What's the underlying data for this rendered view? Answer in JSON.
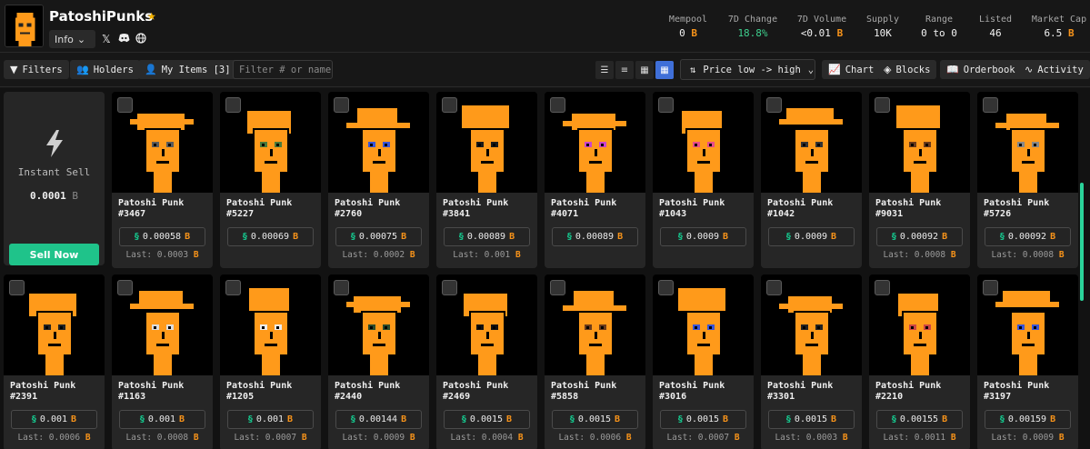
{
  "collection": {
    "name": "PatoshiPunks",
    "info_label": "Info"
  },
  "stats": [
    {
      "label": "Mempool",
      "value": "0",
      "btc": true
    },
    {
      "label": "7D Change",
      "value": "18.8%",
      "btc": false,
      "positive": true
    },
    {
      "label": "7D Volume",
      "value": "<0.01",
      "btc": true
    },
    {
      "label": "Supply",
      "value": "10K",
      "btc": false
    },
    {
      "label": "Range",
      "value": "0 to 0",
      "btc": false
    },
    {
      "label": "Listed",
      "value": "46",
      "btc": false
    },
    {
      "label": "Market Cap",
      "value": "6.5",
      "btc": true
    }
  ],
  "toolbar": {
    "filters": "Filters",
    "holders": "Holders",
    "my_items": "My Items [3]",
    "filter_placeholder": "Filter # or name",
    "sort": "Price low -> high",
    "chart": "Chart",
    "blocks": "Blocks",
    "orderbook": "Orderbook",
    "activity": "Activity"
  },
  "instant_sell": {
    "label": "Instant Sell",
    "price": "0.0001",
    "button": "Sell Now"
  },
  "currency_symbol": "B",
  "colors": {
    "accent": "#f7931a",
    "punk": "#ff9a1a",
    "green": "#1fc38a",
    "active": "#3f6fd8"
  },
  "items": [
    {
      "name": "Patoshi Punk",
      "id": "#3467",
      "price": "0.00058",
      "last": "Last: 0.0003"
    },
    {
      "name": "Patoshi Punk",
      "id": "#5227",
      "price": "0.00069",
      "last": ""
    },
    {
      "name": "Patoshi Punk",
      "id": "#2760",
      "price": "0.00075",
      "last": "Last: 0.0002"
    },
    {
      "name": "Patoshi Punk",
      "id": "#3841",
      "price": "0.00089",
      "last": "Last: 0.001"
    },
    {
      "name": "Patoshi Punk",
      "id": "#4071",
      "price": "0.00089",
      "last": ""
    },
    {
      "name": "Patoshi Punk",
      "id": "#1043",
      "price": "0.0009",
      "last": ""
    },
    {
      "name": "Patoshi Punk",
      "id": "#1042",
      "price": "0.0009",
      "last": ""
    },
    {
      "name": "Patoshi Punk",
      "id": "#9031",
      "price": "0.00092",
      "last": "Last: 0.0008"
    },
    {
      "name": "Patoshi Punk",
      "id": "#5726",
      "price": "0.00092",
      "last": "Last: 0.0008"
    },
    {
      "name": "Patoshi Punk",
      "id": "#2391",
      "price": "0.001",
      "last": "Last: 0.0006"
    },
    {
      "name": "Patoshi Punk",
      "id": "#1163",
      "price": "0.001",
      "last": "Last: 0.0008"
    },
    {
      "name": "Patoshi Punk",
      "id": "#1205",
      "price": "0.001",
      "last": "Last: 0.0007"
    },
    {
      "name": "Patoshi Punk",
      "id": "#2440",
      "price": "0.00144",
      "last": "Last: 0.0009"
    },
    {
      "name": "Patoshi Punk",
      "id": "#2469",
      "price": "0.0015",
      "last": "Last: 0.0004"
    },
    {
      "name": "Patoshi Punk",
      "id": "#5858",
      "price": "0.0015",
      "last": "Last: 0.0006"
    },
    {
      "name": "Patoshi Punk",
      "id": "#3016",
      "price": "0.0015",
      "last": "Last: 0.0007"
    },
    {
      "name": "Patoshi Punk",
      "id": "#3301",
      "price": "0.0015",
      "last": "Last: 0.0003"
    },
    {
      "name": "Patoshi Punk",
      "id": "#2210",
      "price": "0.00155",
      "last": "Last: 0.0011"
    },
    {
      "name": "Patoshi Punk",
      "id": "#3197",
      "price": "0.00159",
      "last": "Last: 0.0009"
    }
  ]
}
